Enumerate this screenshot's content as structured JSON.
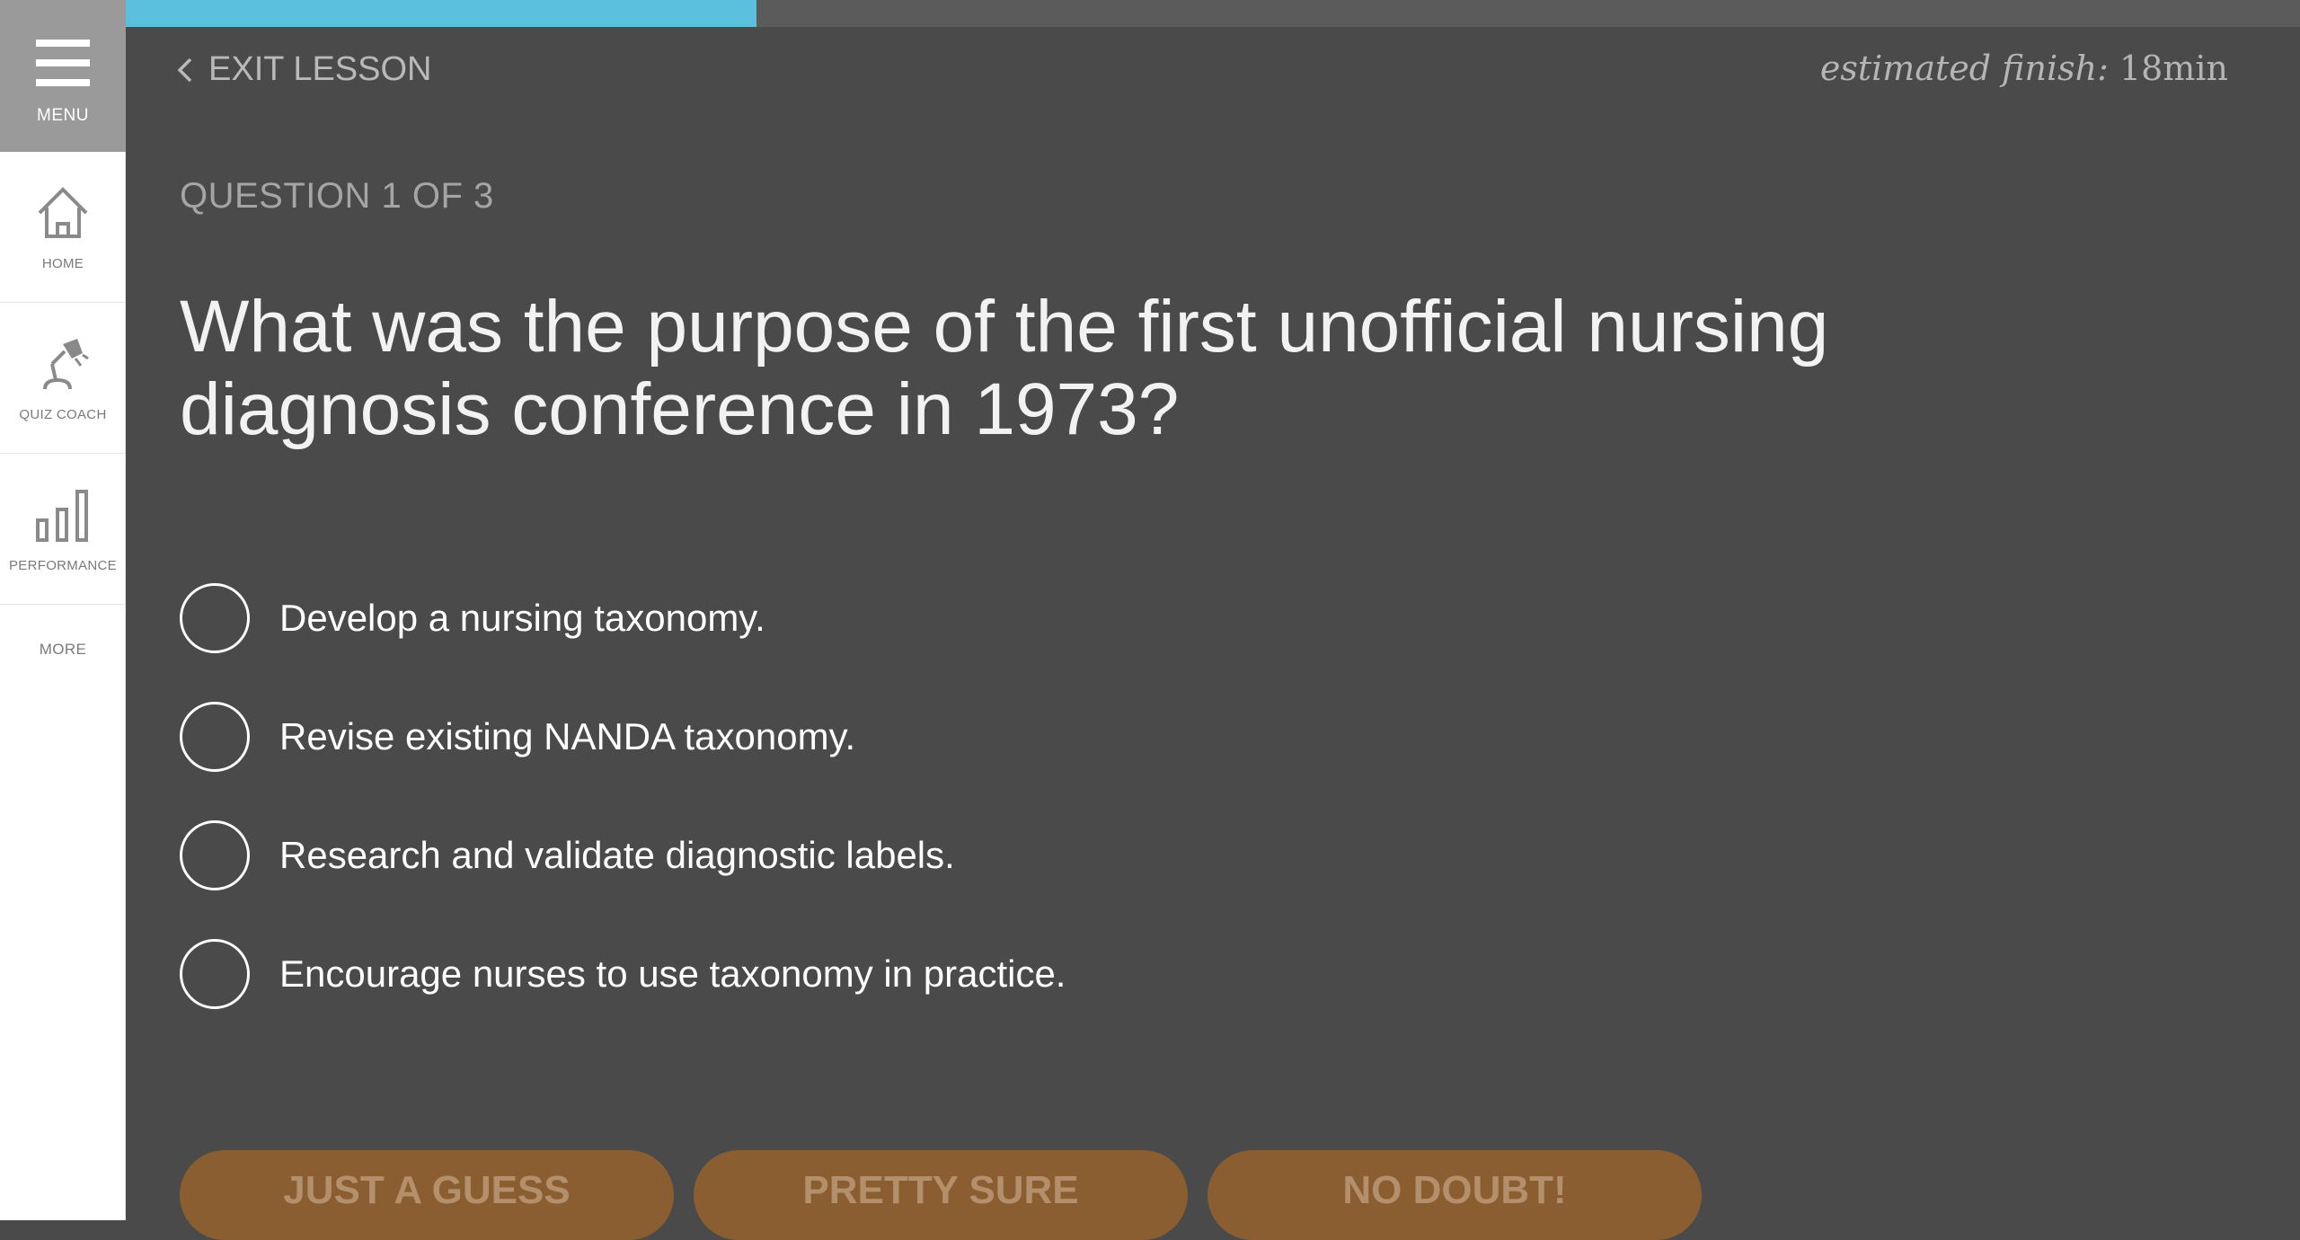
{
  "sidebar": {
    "menu_label": "MENU",
    "items": [
      {
        "label": "HOME",
        "icon": "home-icon"
      },
      {
        "label": "QUIZ COACH",
        "icon": "desk-lamp-icon"
      },
      {
        "label": "PERFORMANCE",
        "icon": "bar-chart-icon"
      }
    ],
    "more_label": "MORE"
  },
  "header": {
    "progress_fraction": 0.29,
    "progress_color": "#5bc0de",
    "exit_label": "EXIT LESSON",
    "estimated_label": "estimated finish:",
    "estimated_value": "18min"
  },
  "question": {
    "counter": "QUESTION 1 OF 3",
    "text": "What was the purpose of the first unofficial nursing diagnosis conference in 1973?",
    "answers": [
      "Develop a nursing taxonomy.",
      "Revise existing NANDA taxonomy.",
      "Research and validate diagnostic labels.",
      "Encourage nurses to use taxonomy in practice."
    ]
  },
  "confidence": {
    "buttons": [
      "JUST A GUESS",
      "PRETTY SURE",
      "NO DOUBT!"
    ],
    "color": "#8a5e30"
  },
  "colors": {
    "background": "#4a4a4a",
    "sidebar": "#ffffff",
    "menu_bg": "#9a9a9a"
  }
}
